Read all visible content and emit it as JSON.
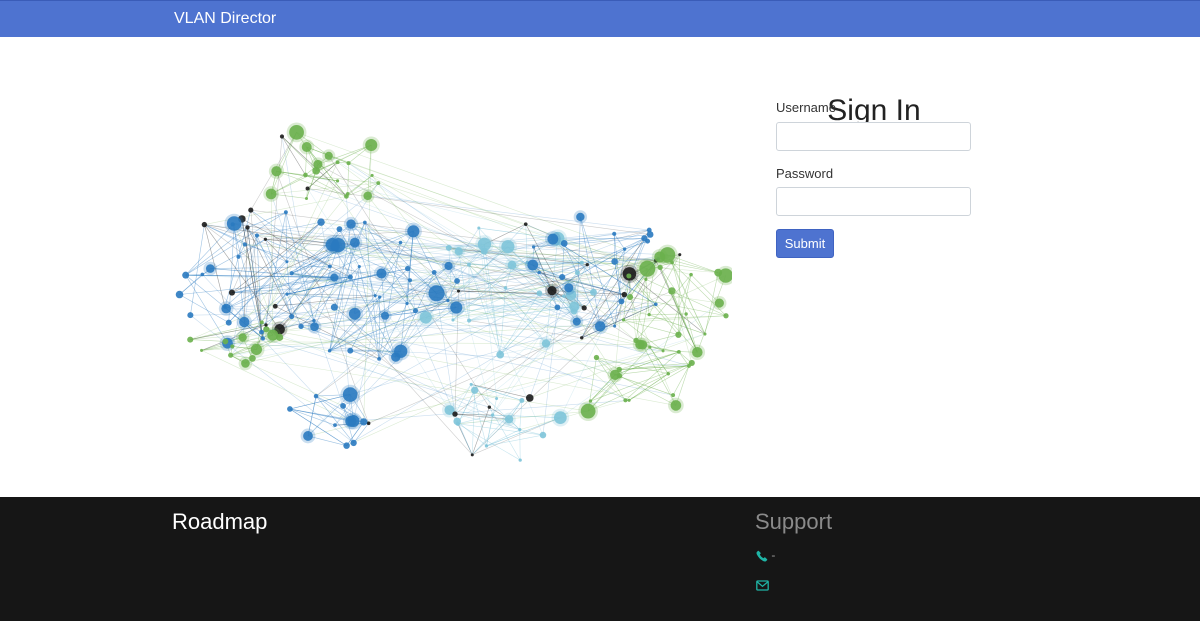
{
  "navbar": {
    "brand": "VLAN Director"
  },
  "hero": {
    "image_name": "network-graph-illustration"
  },
  "signin": {
    "title": "Sign In",
    "username_label": "Username",
    "username_value": "",
    "password_label": "Password",
    "password_value": "",
    "submit_label": "Submit"
  },
  "footer": {
    "roadmap_title": "Roadmap",
    "support_title": "Support",
    "phone_icon": "phone-icon",
    "phone_text": "-",
    "email_icon": "envelope-icon",
    "email_text": ""
  },
  "colors": {
    "navbar": "#4e73d0",
    "footer": "#161616",
    "accent_icon": "#1fb5a6",
    "node_blue": "#2a7ac0",
    "node_light_blue": "#7ec4d9",
    "node_green": "#6ab04c",
    "node_dark": "#1b1b1b"
  }
}
